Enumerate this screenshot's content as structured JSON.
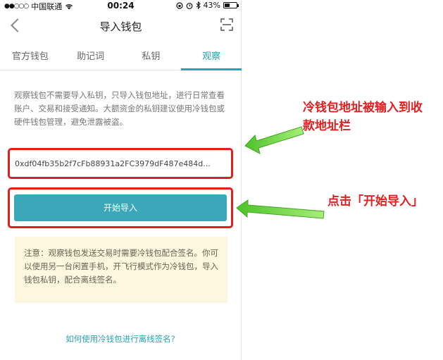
{
  "status_bar": {
    "signal": "●●○○○",
    "carrier": "中国联通",
    "time": "00:24",
    "battery_text": "43%",
    "battery_level": 0.43
  },
  "nav": {
    "title": "导入钱包",
    "back_icon": "chevron-left-icon",
    "scan_icon": "scan-icon"
  },
  "tabs": [
    {
      "label": "官方钱包",
      "active": false
    },
    {
      "label": "助记词",
      "active": false
    },
    {
      "label": "私钥",
      "active": false
    },
    {
      "label": "观察",
      "active": true
    }
  ],
  "description": "观察钱包不需要导入私钥，只导入钱包地址，进行日常查看账户、交易和接受通知。大额资金的私钥建议使用冷钱包或硬件钱包管理，避免泄露被盗。",
  "address_input": {
    "value": "0xdf04fb35b2f7cFb88931a2FC3979dF487e484d..."
  },
  "start_button": {
    "label": "开始导入"
  },
  "notice": "注意：观察钱包发送交易时需要冷钱包配合签名。你可以使用另一台闲置手机，开飞行模式作为冷钱包，导入钱包私钥，配合离线签名。",
  "help_link": "如何使用冷钱包进行离线签名?",
  "annotations": {
    "addr": "冷钱包地址被输入到收款地址栏",
    "button": "点击「开始导入」"
  },
  "colors": {
    "accent": "#2aa3b3",
    "button": "#3aa8b8",
    "highlight": "#e02020",
    "arrow": "#6bd640",
    "notice_bg": "#fdf7e0"
  }
}
